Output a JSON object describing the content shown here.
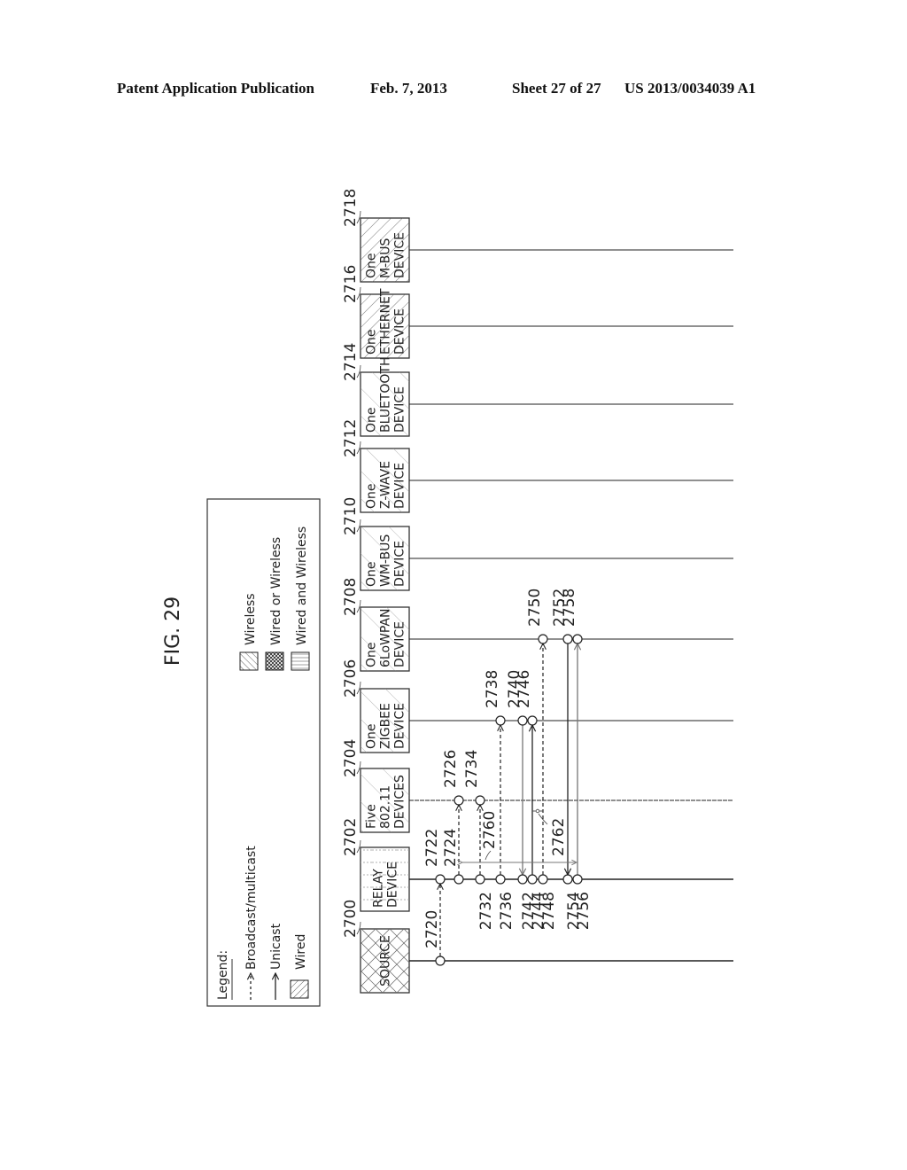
{
  "header": {
    "publication": "Patent Application Publication",
    "date": "Feb. 7, 2013",
    "sheet": "Sheet 27 of 27",
    "number": "US 2013/0034039 A1"
  },
  "figure": {
    "title": "FIG. 29"
  },
  "legend": {
    "title": "Legend:",
    "arrows": [
      {
        "style": "dashed",
        "label": "Broadcast/multicast"
      },
      {
        "style": "solid",
        "label": "Unicast"
      }
    ],
    "fills": [
      {
        "pattern": "wired",
        "label": "Wired"
      },
      {
        "pattern": "wireless",
        "label": "Wireless"
      },
      {
        "pattern": "wired-or-wireless",
        "label": "Wired or Wireless"
      },
      {
        "pattern": "wired-and-wireless",
        "label": "Wired and Wireless"
      }
    ]
  },
  "devices": [
    {
      "ref": "2700",
      "lines": [
        "SOURCE"
      ],
      "pattern": "wired-or-wireless"
    },
    {
      "ref": "2702",
      "lines": [
        "RELAY",
        "DEVICE"
      ],
      "pattern": "wired-and-wireless"
    },
    {
      "ref": "2704",
      "lines": [
        "Five",
        "802.11",
        "DEVICES"
      ],
      "pattern": "wireless"
    },
    {
      "ref": "2706",
      "lines": [
        "One",
        "ZIGBEE",
        "DEVICE"
      ],
      "pattern": "wireless"
    },
    {
      "ref": "2708",
      "lines": [
        "One",
        "6LoWPAN",
        "DEVICE"
      ],
      "pattern": "wireless"
    },
    {
      "ref": "2710",
      "lines": [
        "One",
        "WM-BUS",
        "DEVICE"
      ],
      "pattern": "wireless"
    },
    {
      "ref": "2712",
      "lines": [
        "One",
        "Z-WAVE",
        "DEVICE"
      ],
      "pattern": "wireless"
    },
    {
      "ref": "2714",
      "lines": [
        "One",
        "BLUETOOTH",
        "DEVICE"
      ],
      "pattern": "wireless"
    },
    {
      "ref": "2716",
      "lines": [
        "One",
        "ETHERNET",
        "DEVICE"
      ],
      "pattern": "wired"
    },
    {
      "ref": "2718",
      "lines": [
        "One",
        "M-BUS",
        "DEVICE"
      ],
      "pattern": "wired"
    }
  ],
  "messages": [
    {
      "from": 0,
      "to": 1,
      "step": 0,
      "style": "dashed",
      "from_ref": "2720",
      "to_ref": "2722"
    },
    {
      "from": 1,
      "to": 2,
      "step": 1,
      "style": "dashed",
      "from_ref": "2724",
      "to_ref": "2726"
    },
    {
      "from": 1,
      "to": 2,
      "step": 2,
      "style": "dashed",
      "from_ref": "2732",
      "to_ref": "2734"
    },
    {
      "from": 1,
      "to": 3,
      "step": 3,
      "style": "dashed",
      "from_ref": "2736",
      "to_ref": "2738"
    },
    {
      "from": 3,
      "to": 1,
      "step": 4,
      "style": "solid-gray",
      "from_ref": "2740",
      "to_ref": "2742"
    },
    {
      "from": 1,
      "to": 3,
      "step": 5,
      "style": "solid",
      "from_ref": "2744",
      "to_ref": "2746"
    },
    {
      "from": 1,
      "to": 4,
      "step": 6,
      "style": "dashed",
      "from_ref": "2748",
      "to_ref": "2750"
    },
    {
      "from": 4,
      "to": 1,
      "step": 7,
      "style": "solid",
      "from_ref": "2752",
      "to_ref": "2754"
    },
    {
      "from": 1,
      "to": 4,
      "step": 8,
      "style": "solid-gray",
      "from_ref": "2756",
      "to_ref": "2758"
    }
  ],
  "spans": [
    {
      "ref": "2760",
      "from_step": 1,
      "to_step": 8
    },
    {
      "ref": "2762",
      "from_step": 5,
      "to_step": 6
    }
  ]
}
